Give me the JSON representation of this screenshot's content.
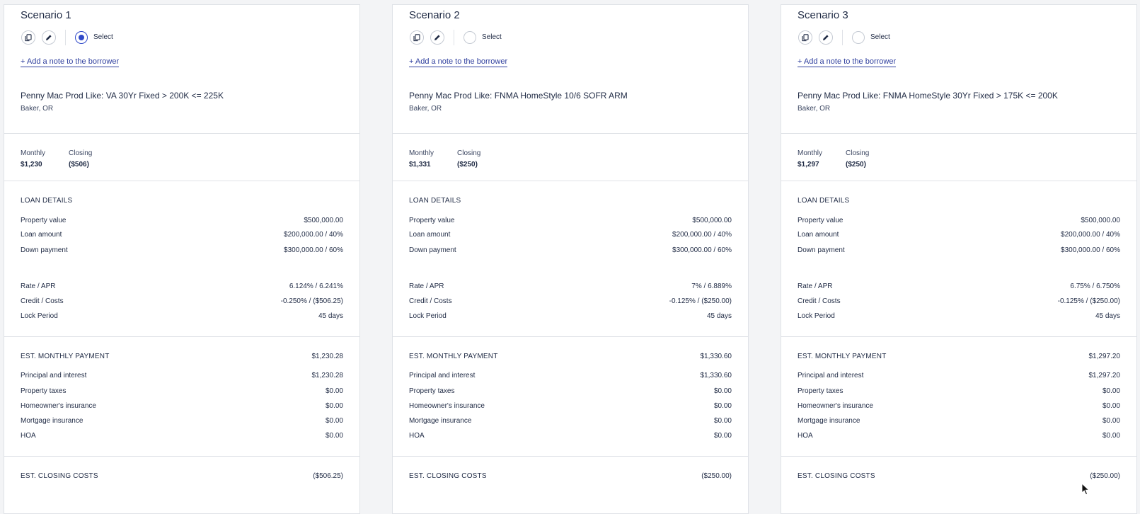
{
  "scenarios": [
    {
      "title": "Scenario 1",
      "selected": true,
      "select_label": "Select",
      "note_link": "+ Add a note to the borrower",
      "product": "Penny Mac Prod Like: VA 30Yr Fixed > 200K <= 225K",
      "location": "Baker, OR",
      "summary": {
        "monthly_label": "Monthly",
        "monthly": "$1,230",
        "closing_label": "Closing",
        "closing": "($506)"
      },
      "loan_details": {
        "heading": "LOAN DETAILS",
        "property_value_label": "Property value",
        "property_value": "$500,000.00",
        "loan_amount_label": "Loan amount",
        "loan_amount": "$200,000.00 / 40%",
        "down_payment_label": "Down payment",
        "down_payment": "$300,000.00 / 60%",
        "rate_label": "Rate / APR",
        "rate": "6.124% / 6.241%",
        "credit_label": "Credit / Costs",
        "credit": "-0.250% / ($506.25)",
        "lock_label": "Lock Period",
        "lock": "45 days"
      },
      "monthly_payment": {
        "heading": "EST. MONTHLY PAYMENT",
        "total": "$1,230.28",
        "pi_label": "Principal and interest",
        "pi": "$1,230.28",
        "taxes_label": "Property taxes",
        "taxes": "$0.00",
        "hoi_label": "Homeowner's insurance",
        "hoi": "$0.00",
        "mi_label": "Mortgage insurance",
        "mi": "$0.00",
        "hoa_label": "HOA",
        "hoa": "$0.00"
      },
      "closing_costs": {
        "heading": "EST. CLOSING COSTS",
        "total": "($506.25)"
      }
    },
    {
      "title": "Scenario 2",
      "selected": false,
      "select_label": "Select",
      "note_link": "+ Add a note to the borrower",
      "product": "Penny Mac Prod Like: FNMA HomeStyle 10/6 SOFR ARM",
      "location": "Baker, OR",
      "summary": {
        "monthly_label": "Monthly",
        "monthly": "$1,331",
        "closing_label": "Closing",
        "closing": "($250)"
      },
      "loan_details": {
        "heading": "LOAN DETAILS",
        "property_value_label": "Property value",
        "property_value": "$500,000.00",
        "loan_amount_label": "Loan amount",
        "loan_amount": "$200,000.00 / 40%",
        "down_payment_label": "Down payment",
        "down_payment": "$300,000.00 / 60%",
        "rate_label": "Rate / APR",
        "rate": "7% / 6.889%",
        "credit_label": "Credit / Costs",
        "credit": "-0.125% / ($250.00)",
        "lock_label": "Lock Period",
        "lock": "45 days"
      },
      "monthly_payment": {
        "heading": "EST. MONTHLY PAYMENT",
        "total": "$1,330.60",
        "pi_label": "Principal and interest",
        "pi": "$1,330.60",
        "taxes_label": "Property taxes",
        "taxes": "$0.00",
        "hoi_label": "Homeowner's insurance",
        "hoi": "$0.00",
        "mi_label": "Mortgage insurance",
        "mi": "$0.00",
        "hoa_label": "HOA",
        "hoa": "$0.00"
      },
      "closing_costs": {
        "heading": "EST. CLOSING COSTS",
        "total": "($250.00)"
      }
    },
    {
      "title": "Scenario 3",
      "selected": false,
      "select_label": "Select",
      "note_link": "+ Add a note to the borrower",
      "product": "Penny Mac Prod Like: FNMA HomeStyle 30Yr Fixed > 175K <= 200K",
      "location": "Baker, OR",
      "summary": {
        "monthly_label": "Monthly",
        "monthly": "$1,297",
        "closing_label": "Closing",
        "closing": "($250)"
      },
      "loan_details": {
        "heading": "LOAN DETAILS",
        "property_value_label": "Property value",
        "property_value": "$500,000.00",
        "loan_amount_label": "Loan amount",
        "loan_amount": "$200,000.00 / 40%",
        "down_payment_label": "Down payment",
        "down_payment": "$300,000.00 / 60%",
        "rate_label": "Rate / APR",
        "rate": "6.75% / 6.750%",
        "credit_label": "Credit / Costs",
        "credit": "-0.125% / ($250.00)",
        "lock_label": "Lock Period",
        "lock": "45 days"
      },
      "monthly_payment": {
        "heading": "EST. MONTHLY PAYMENT",
        "total": "$1,297.20",
        "pi_label": "Principal and interest",
        "pi": "$1,297.20",
        "taxes_label": "Property taxes",
        "taxes": "$0.00",
        "hoi_label": "Homeowner's insurance",
        "hoi": "$0.00",
        "mi_label": "Mortgage insurance",
        "mi": "$0.00",
        "hoa_label": "HOA",
        "hoa": "$0.00"
      },
      "closing_costs": {
        "heading": "EST. CLOSING COSTS",
        "total": "($250.00)"
      }
    }
  ],
  "colors": {
    "accent": "#2f49c9",
    "link": "#2f3f9e",
    "text": "#1f2a44",
    "divider": "#dfe2e7"
  },
  "icons": {
    "copy": "copy-icon",
    "edit": "pencil-icon",
    "cursor": "mouse-pointer-icon"
  }
}
